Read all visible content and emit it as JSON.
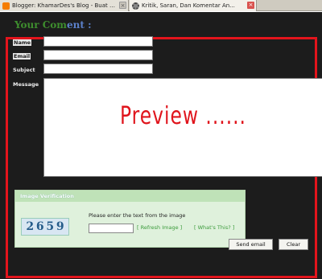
{
  "browser": {
    "tabs": [
      {
        "label": "Blogger: KhamarDes's Blog - Buat Entri",
        "icon": "blogger-icon"
      },
      {
        "label": "Kritik, Saran, Dan Komentar An...",
        "icon": "loading-icon"
      }
    ]
  },
  "page": {
    "heading_main": "Your Com",
    "heading_tail": "ent :"
  },
  "form": {
    "name_label": "Name",
    "email_label": "Email",
    "subject_label": "Subject",
    "message_label": "Message",
    "preview_text": "Preview ......"
  },
  "verification": {
    "title": "Image Verification",
    "captcha_chars": [
      "2",
      "6",
      "5",
      "9"
    ],
    "instruction": "Please enter the text from the image",
    "refresh_link": "[ Refresh Image ]",
    "whats_this_link": "[ What's This? ]"
  },
  "buttons": {
    "send": "Send email",
    "clear": "Clear"
  },
  "colors": {
    "highlight": "#e3141c",
    "heading_green": "#3e8e2e",
    "panel_green": "#dff1dc"
  }
}
